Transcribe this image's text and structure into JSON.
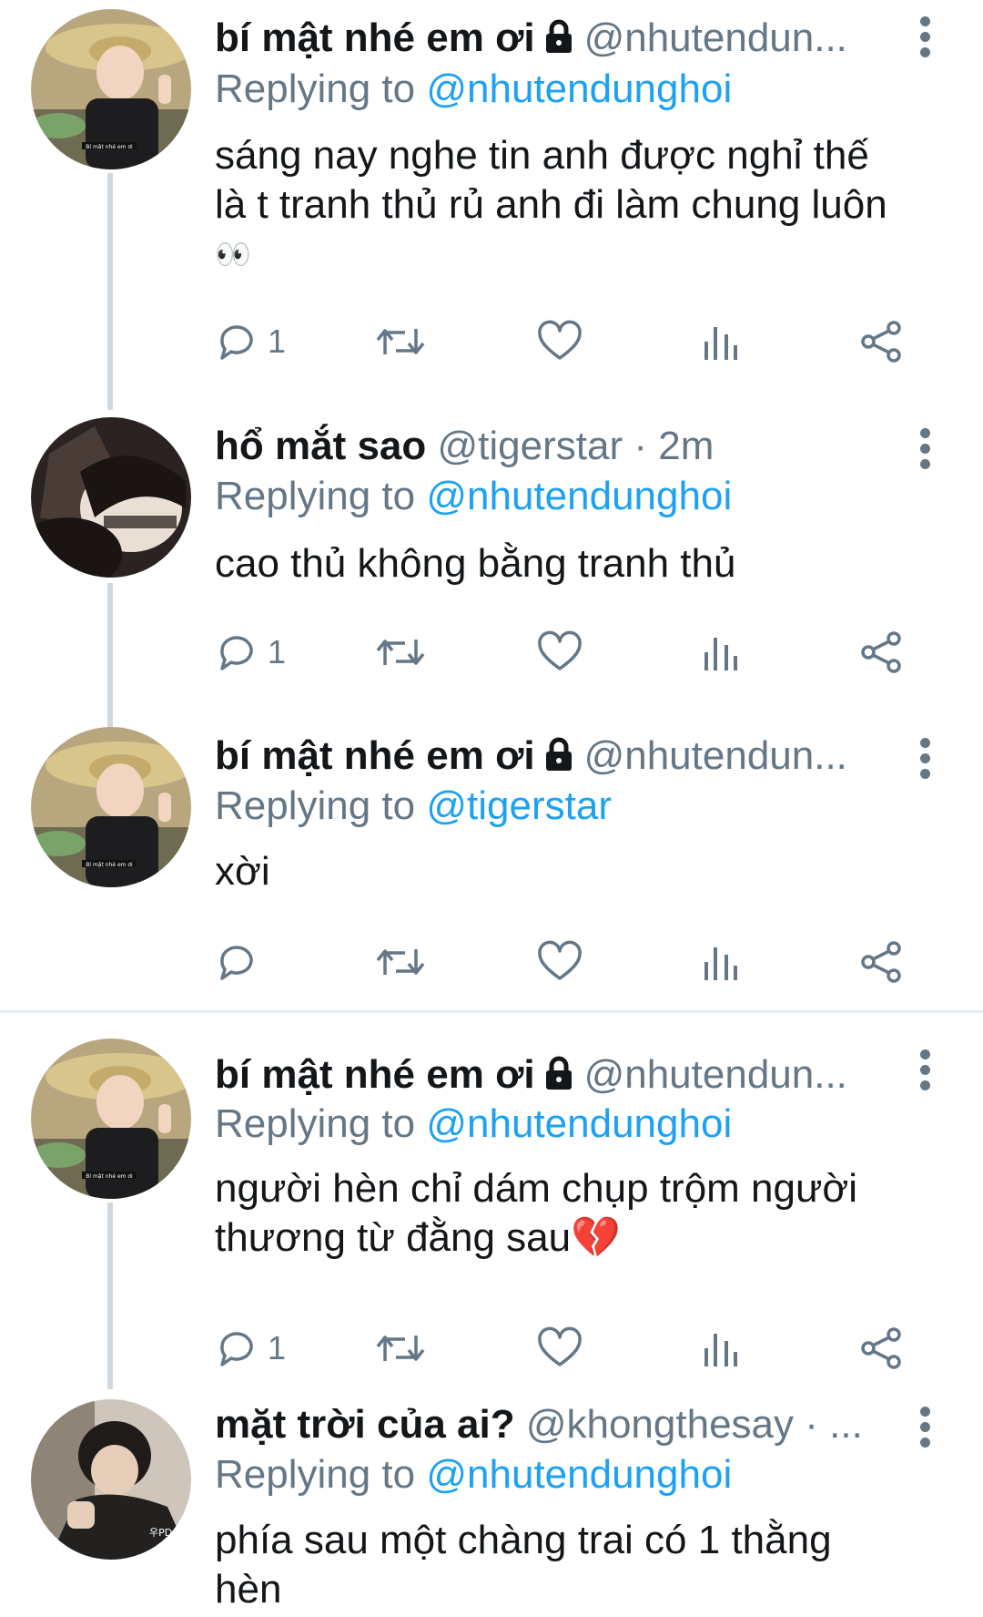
{
  "colors": {
    "text": "#14171a",
    "secondary": "#657786",
    "link": "#1da1f2",
    "line": "#cfd9de"
  },
  "tweets": [
    {
      "name": "bí mật nhé em ơi",
      "handle": "@nhutendun...",
      "reply_prefix": "Replying to",
      "reply_to": "@nhutendunghoi",
      "text_line1": "sáng nay nghe tin anh được nghỉ thế",
      "text_line2": "là t tranh thủ rủ anh đi làm chung luôn",
      "text_line3": "👀",
      "reply_count": "1",
      "avatar_caption": "Bí mật nhé em ơi"
    },
    {
      "name": "hổ mắt sao",
      "handle": "@tigerstar · 2m",
      "reply_prefix": "Replying to",
      "reply_to": "@nhutendunghoi",
      "text_line1": "cao thủ không bằng tranh thủ",
      "reply_count": "1"
    },
    {
      "name": "bí mật nhé em ơi",
      "handle": "@nhutendun...",
      "reply_prefix": "Replying to",
      "reply_to": "@tigerstar",
      "text_line1": "xời",
      "reply_count": "",
      "avatar_caption": "Bí mật nhé em ơi"
    },
    {
      "name": "bí mật nhé em ơi",
      "handle": "@nhutendun...",
      "reply_prefix": "Replying to",
      "reply_to": "@nhutendunghoi",
      "text_line1": "người hèn chỉ dám chụp trộm người",
      "text_line2": "thương từ đằng sau💔",
      "reply_count": "1",
      "avatar_caption": "Bí mật nhé em ơi"
    },
    {
      "name": "mặt trời của ai?",
      "handle": "@khongthesay · ...",
      "reply_prefix": "Replying to",
      "reply_to": "@nhutendunghoi",
      "text_line1": "phía sau một chàng trai có 1 thằng",
      "text_line2": "hèn",
      "avatar_caption": "우PD"
    }
  ],
  "icons": [
    "reply-icon",
    "retweet-icon",
    "like-icon",
    "analytics-icon",
    "share-icon",
    "lock-icon",
    "more-icon"
  ]
}
